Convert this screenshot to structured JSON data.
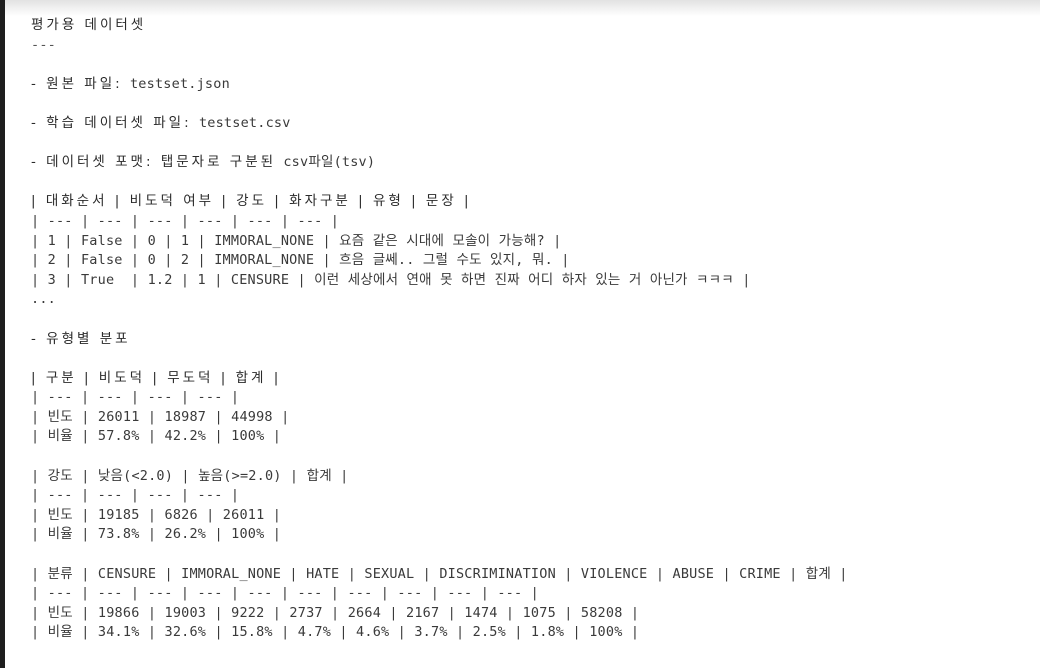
{
  "document": {
    "title": "평가용 데이터셋",
    "rule": "---",
    "bullets": {
      "source_file_label": "- 원본 파일: ",
      "source_file_value": "testset.json",
      "train_file_label": "- 학습 데이터셋 파일: ",
      "train_file_value": "testset.csv",
      "format_label": "- 데이터셋 포맷: 탭문자로 구분된 ",
      "format_value": "csv파일(tsv)"
    },
    "sample_table": {
      "header": "| 대화순서 | 비도덕 여부 | 강도 | 화자구분 | 유형 | 문장 |",
      "separator": "| --- | --- | --- | --- | --- | --- |",
      "rows": [
        "| 1 | False | 0 | 1 | IMMORAL_NONE | 요즘 같은 시대에 모솔이 가능해? |",
        "| 2 | False | 0 | 2 | IMMORAL_NONE | 흐음 글쎄.. 그럴 수도 있지, 뭐. |",
        "| 3 | True  | 1.2 | 1 | CENSURE | 이런 세상에서 연애 못 하면 진짜 어디 하자 있는 거 아닌가 ㅋㅋㅋ |"
      ],
      "ellipsis": "..."
    },
    "distribution_heading": "- 유형별 분포",
    "moral_table": {
      "header": "| 구분 | 비도덕 | 무도덕 | 합계 |",
      "separator": "| --- | --- | --- | --- |",
      "rows": [
        "| 빈도 | 26011 | 18987 | 44998 |",
        "| 비율 | 57.8% | 42.2% | 100% |"
      ]
    },
    "intensity_table": {
      "header": "| 강도 | 낮음(<2.0) | 높음(>=2.0) | 합계 |",
      "separator": "| --- | --- | --- | --- |",
      "rows": [
        "| 빈도 | 19185 | 6826 | 26011 |",
        "| 비율 | 73.8% | 26.2% | 100% |"
      ]
    },
    "category_table": {
      "header": "| 분류 | CENSURE | IMMORAL_NONE | HATE | SEXUAL | DISCRIMINATION | VIOLENCE | ABUSE | CRIME | 합계 |",
      "separator": "| --- | --- | --- | --- | --- | --- | --- | --- | --- | --- |",
      "rows": [
        "| 빈도 | 19866 | 19003 | 9222 | 2737 | 2664 | 2167 | 1474 | 1075 | 58208 |",
        "| 비율 | 34.1% | 32.6% | 15.8% | 4.7% | 4.6% | 3.7% | 2.5% | 1.8% | 100% |"
      ]
    }
  }
}
